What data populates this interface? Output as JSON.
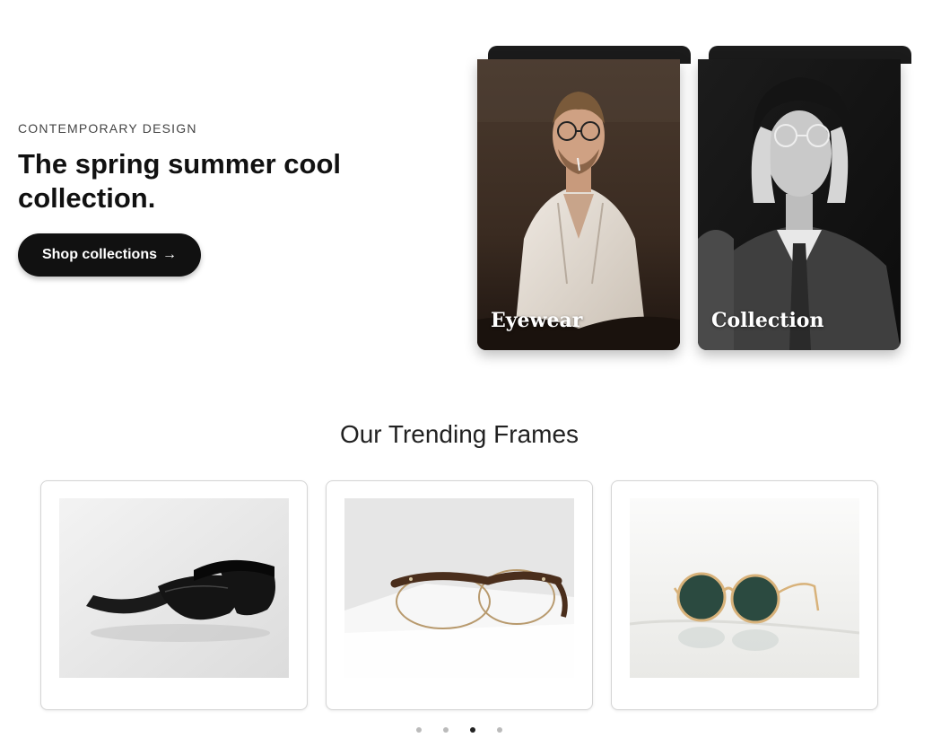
{
  "hero": {
    "eyebrow": "CONTEMPORARY DESIGN",
    "headline": "The spring summer cool collection.",
    "cta_label": "Shop collections",
    "cta_arrow": "→"
  },
  "categories": [
    {
      "label": "Eyewear",
      "image": "man-in-white-shirt-wearing-glasses-photo"
    },
    {
      "label": "Collection",
      "image": "person-in-suit-adjusting-glasses-bw-photo"
    }
  ],
  "trending": {
    "title": "Our Trending Frames",
    "products": [
      {
        "image": "black-wayfarer-sunglasses-photo"
      },
      {
        "image": "tortoise-browline-glasses-on-book-photo"
      },
      {
        "image": "round-gold-sunglasses-on-marble-photo"
      }
    ],
    "carousel_total": 4,
    "carousel_active_index": 3
  },
  "colors": {
    "primary": "#111111",
    "dot_inactive": "#bbbbbb",
    "dot_active": "#222222"
  }
}
